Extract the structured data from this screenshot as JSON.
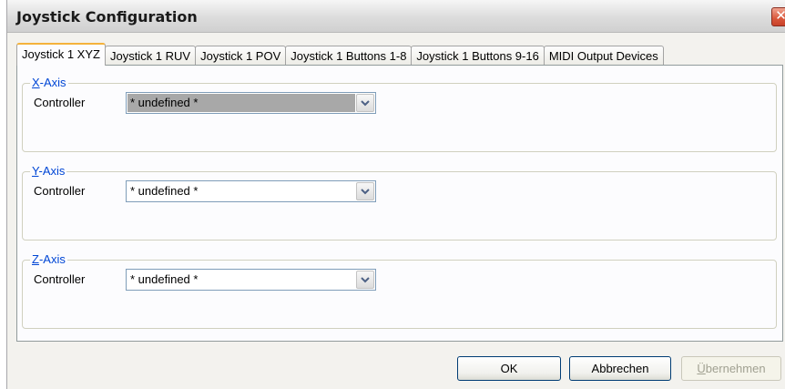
{
  "window": {
    "title": "Joystick Configuration",
    "close_icon": "close-icon"
  },
  "tabs": [
    {
      "label": "Joystick 1 XYZ",
      "active": true
    },
    {
      "label": "Joystick 1 RUV",
      "active": false
    },
    {
      "label": "Joystick 1 POV",
      "active": false
    },
    {
      "label": "Joystick 1 Buttons 1-8",
      "active": false
    },
    {
      "label": "Joystick 1 Buttons 9-16",
      "active": false
    },
    {
      "label": "MIDI Output Devices",
      "active": false
    }
  ],
  "axes": [
    {
      "mnemonic": "X",
      "rest": "-Axis",
      "controller_label": "Controller",
      "value": "* undefined *",
      "focused": true
    },
    {
      "mnemonic": "Y",
      "rest": "-Axis",
      "controller_label": "Controller",
      "value": "* undefined *",
      "focused": false
    },
    {
      "mnemonic": "Z",
      "rest": "-Axis",
      "controller_label": "Controller",
      "value": "* undefined *",
      "focused": false
    }
  ],
  "buttons": {
    "ok": "OK",
    "cancel": "Abbrechen",
    "apply_mnemonic": "Ü",
    "apply_rest": "bernehmen",
    "apply_enabled": false
  },
  "colors": {
    "legend": "#0046d5",
    "active_tab_accent": "#f4b23b",
    "close_button": "#d9573a"
  }
}
